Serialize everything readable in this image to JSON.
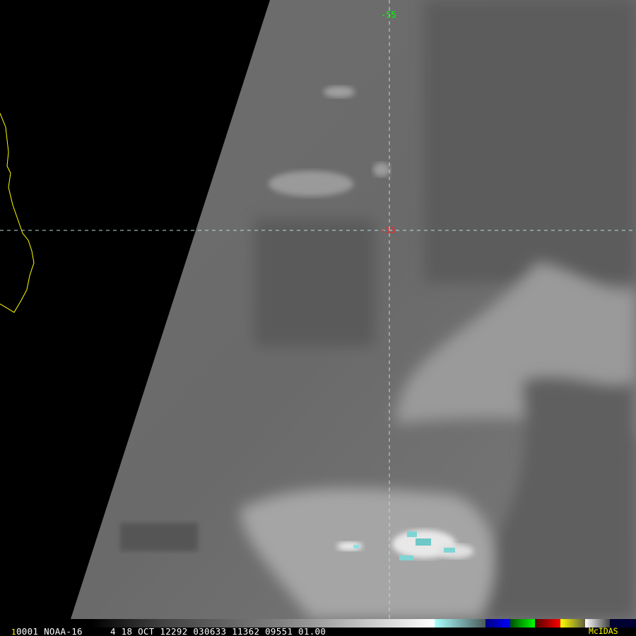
{
  "image": {
    "frame_number": "1",
    "info_line": "0001 NOAA-16     4 18 OCT 12292 030633 11362 09551 01.00",
    "brand": "McIDAS",
    "grid_labels": {
      "longitude": "-55",
      "latitude": "-15"
    },
    "colors": {
      "coastline": "#ffff00",
      "grid": "#9ff6f6",
      "longitude_label": "#00ff00",
      "latitude_label": "#ff0000",
      "brand": "#ffff00",
      "frame_number": "#ffff00"
    }
  }
}
